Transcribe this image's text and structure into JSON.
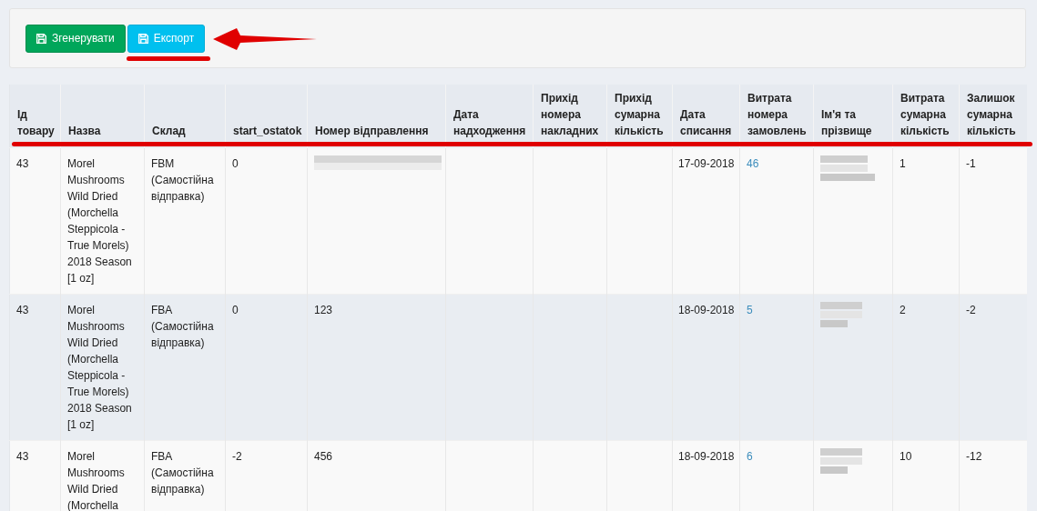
{
  "toolbar": {
    "buttons": [
      {
        "label": "Згенерувати",
        "kind": "success"
      },
      {
        "label": "Експорт",
        "kind": "info"
      }
    ]
  },
  "table": {
    "columns": [
      "Ід товару",
      "Назва",
      "Склад",
      "start_ostatok",
      "Номер відправлення",
      "Дата надходження",
      "Прихід номера накладних",
      "Прихід сумарна кількість",
      "Дата списання",
      "Витрата номера замовлень",
      "Ім'я та прізвище",
      "Витрата сумарна кількість",
      "Залишок сумарна кількість"
    ],
    "rows": [
      {
        "id": "43",
        "name": "Morel Mushrooms Wild Dried (Morchella Steppicola - True Morels) 2018 Season [1 oz]",
        "warehouse": "FBM (Самостійна відправка)",
        "start_ostatok": "0",
        "shipment_redacted": true,
        "write_off_date": "17-09-2018",
        "order_no": "46",
        "customer_redacted": true,
        "spent_qty": "1",
        "balance": "-1"
      },
      {
        "id": "43",
        "name": "Morel Mushrooms Wild Dried (Morchella Steppicola - True Morels) 2018 Season [1 oz]",
        "warehouse": "FBA (Самостійна відправка)",
        "start_ostatok": "0",
        "shipment": "123",
        "write_off_date": "18-09-2018",
        "order_no": "5",
        "customer_redacted": true,
        "spent_qty": "2",
        "balance": "-2"
      },
      {
        "id": "43",
        "name": "Morel Mushrooms Wild Dried (Morchella",
        "warehouse": "FBA (Самостійна відправка)",
        "start_ostatok": "-2",
        "shipment": "456",
        "write_off_date": "18-09-2018",
        "order_no": "6",
        "customer_redacted": true,
        "spent_qty": "10",
        "balance": "-12"
      }
    ]
  }
}
